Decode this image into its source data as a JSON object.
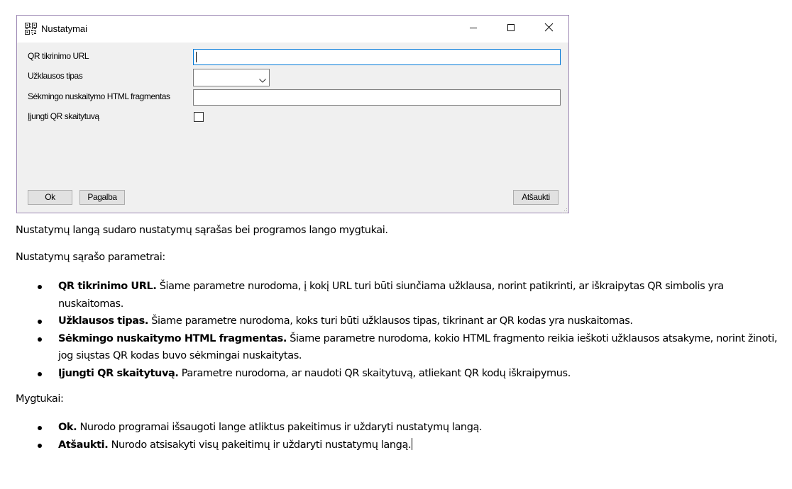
{
  "dialog": {
    "title": "Nustatymai",
    "fields": {
      "qr_url_label": "QR tikrinimo URL",
      "qr_url_value": "",
      "request_type_label": "Užklausos tipas",
      "request_type_value": "",
      "html_fragment_label": "Sėkmingo nuskaitymo HTML fragmentas",
      "html_fragment_value": "",
      "enable_scanner_label": "Įjungti QR skaitytuvą"
    },
    "buttons": {
      "ok": "Ok",
      "help": "Pagalba",
      "cancel": "Atšaukti"
    }
  },
  "document": {
    "intro": "Nustatymų langą sudaro nustatymų sąrašas bei programos lango mygtukai.",
    "params_heading": "Nustatymų sąrašo parametrai:",
    "params": [
      {
        "term": "QR tikrinimo URL.",
        "desc": " Šiame parametre nurodoma, į kokį URL turi būti siunčiama užklausa, norint patikrinti, ar iškraipytas QR simbolis yra nuskaitomas."
      },
      {
        "term": "Užklausos tipas.",
        "desc": " Šiame parametre nurodoma, koks turi būti užklausos tipas, tikrinant ar QR kodas yra nuskaitomas."
      },
      {
        "term": "Sėkmingo nuskaitymo HTML fragmentas.",
        "desc": " Šiame parametre nurodoma, kokio HTML fragmento reikia ieškoti užklausos atsakyme, norint žinoti, jog siųstas QR kodas buvo sėkmingai nuskaitytas."
      },
      {
        "term": "Įjungti QR skaitytuvą.",
        "desc": " Parametre nurodoma, ar naudoti QR skaitytuvą, atliekant QR kodų iškraipymus."
      }
    ],
    "buttons_heading": "Mygtukai:",
    "buttons": [
      {
        "term": "Ok.",
        "desc": " Nurodo programai išsaugoti lange atliktus pakeitimus ir uždaryti nustatymų langą."
      },
      {
        "term": "Atšaukti.",
        "desc": " Nurodo atsisakyti visų pakeitimų ir uždaryti nustatymų langą."
      }
    ]
  },
  "icons": {
    "app": "qr-code-icon",
    "minimize": "minimize-icon",
    "maximize": "maximize-icon",
    "close": "close-icon"
  }
}
